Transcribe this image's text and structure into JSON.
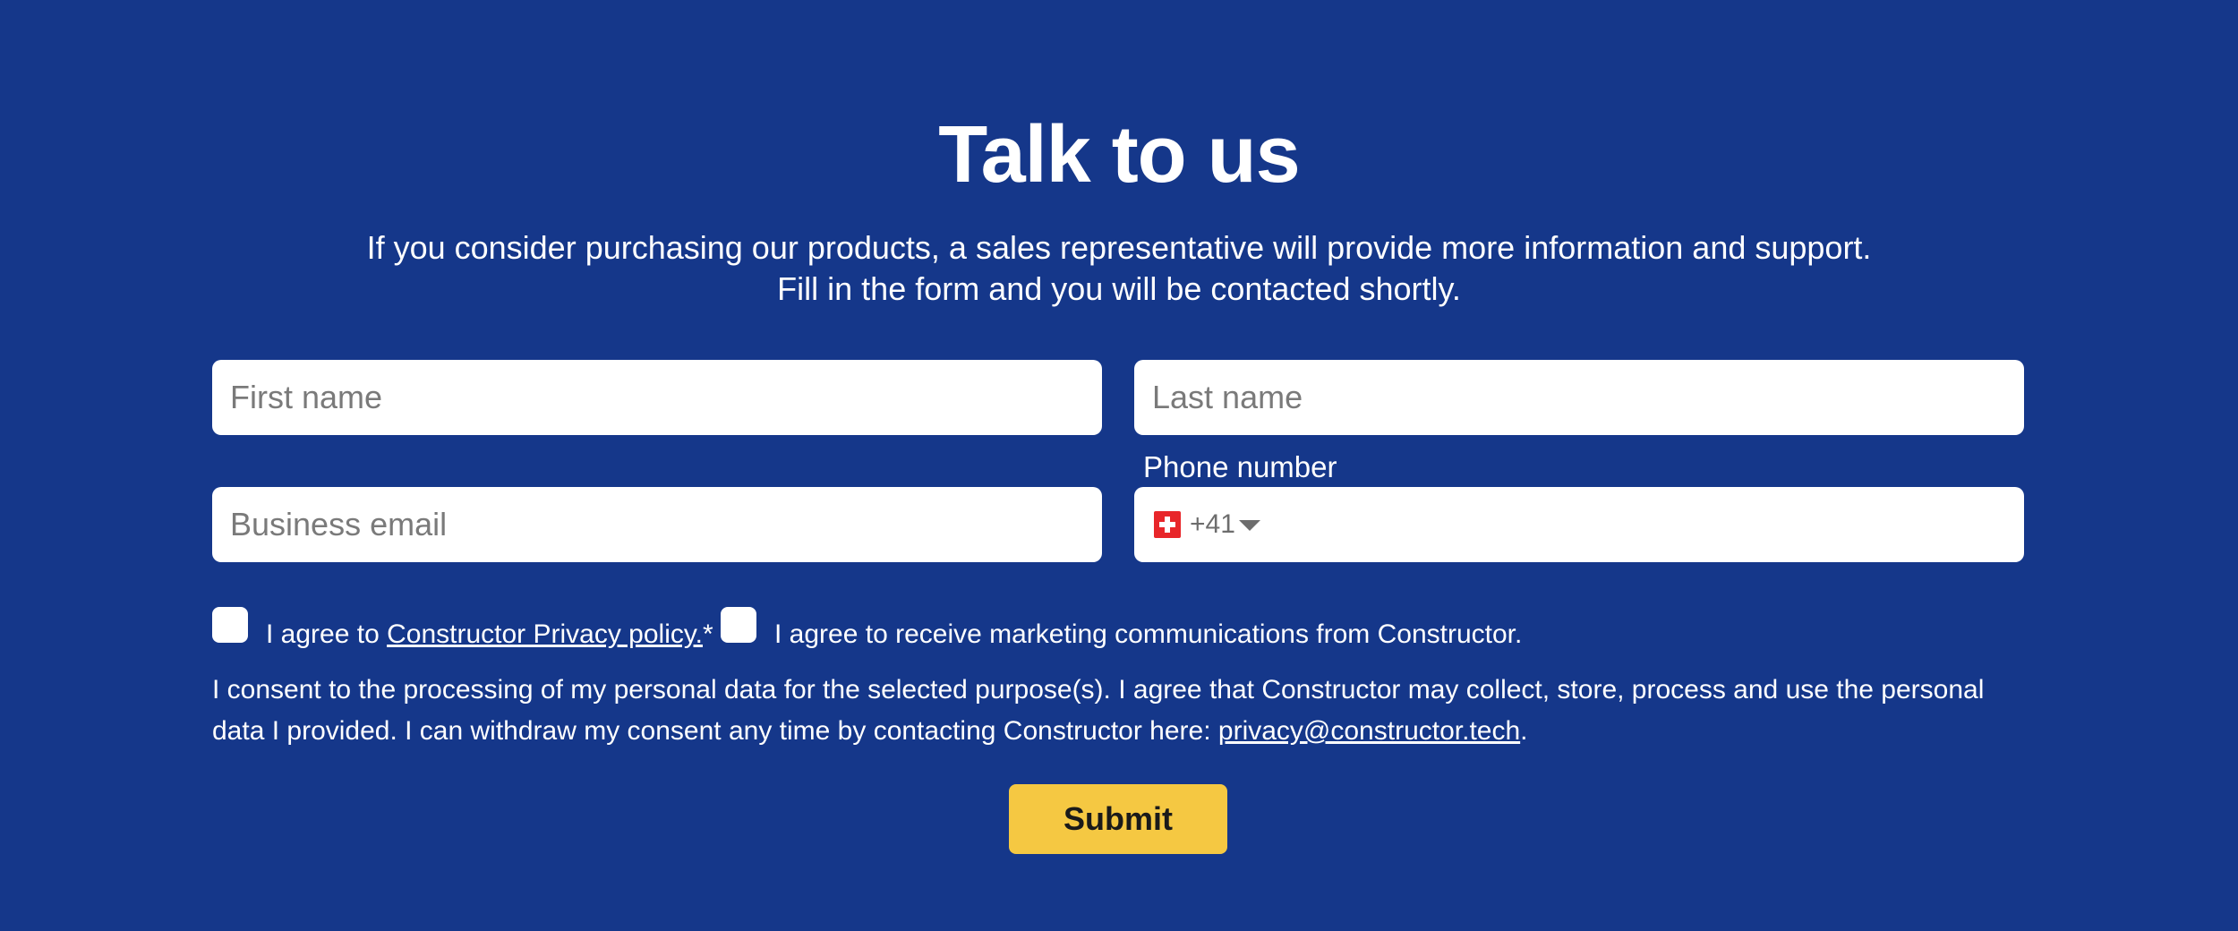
{
  "header": {
    "title": "Talk to us",
    "subtitle_line1": "If you consider purchasing our products, a sales representative will provide more information and support.",
    "subtitle_line2": "Fill in the form and you will be contacted shortly."
  },
  "form": {
    "first_name": {
      "placeholder": "First name",
      "value": ""
    },
    "last_name": {
      "placeholder": "Last name",
      "value": ""
    },
    "business_email": {
      "placeholder": "Business email",
      "value": ""
    },
    "phone": {
      "label": "Phone number",
      "country_flag": "switzerland-flag-icon",
      "dial_code": "+41",
      "value": ""
    },
    "privacy_checkbox": {
      "prefix": "I agree to ",
      "link_text": "Constructor Privacy policy.",
      "suffix": "*",
      "checked": false
    },
    "marketing_checkbox": {
      "label": "I agree to receive marketing communications from Constructor.",
      "checked": false
    },
    "consent": {
      "text": "I consent to the processing of my personal data for the selected purpose(s). I agree that Constructor may collect, store, process and use the personal data I provided. I can withdraw my consent any time by contacting Constructor here: ",
      "email_link": "privacy@constructor.tech",
      "end": "."
    },
    "submit_label": "Submit"
  },
  "colors": {
    "background": "#15378a",
    "submit_button": "#f5c842",
    "text": "#ffffff"
  }
}
